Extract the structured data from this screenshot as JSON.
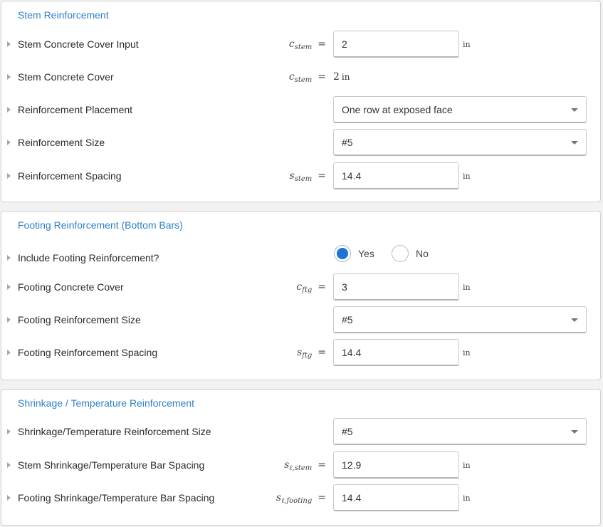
{
  "stem": {
    "title": "Stem Reinforcement",
    "rows": {
      "cover_input": {
        "label": "Stem Concrete Cover Input",
        "sym": "c",
        "sub": "stem",
        "value": "2",
        "unit": "in"
      },
      "cover": {
        "label": "Stem Concrete Cover",
        "sym": "c",
        "sub": "stem",
        "value": "2",
        "unit": "in"
      },
      "placement": {
        "label": "Reinforcement Placement",
        "value": "One row at exposed face"
      },
      "size": {
        "label": "Reinforcement Size",
        "value": "#5"
      },
      "spacing": {
        "label": "Reinforcement Spacing",
        "sym": "s",
        "sub": "stem",
        "value": "14.4",
        "unit": "in"
      }
    }
  },
  "footing": {
    "title": "Footing Reinforcement (Bottom Bars)",
    "rows": {
      "include": {
        "label": "Include Footing Reinforcement?",
        "yes": "Yes",
        "no": "No",
        "selected": "Yes"
      },
      "cover": {
        "label": "Footing Concrete Cover",
        "sym": "c",
        "sub": "ftg",
        "value": "3",
        "unit": "in"
      },
      "size": {
        "label": "Footing Reinforcement Size",
        "value": "#5"
      },
      "spacing": {
        "label": "Footing Reinforcement Spacing",
        "sym": "s",
        "sub": "ftg",
        "value": "14.4",
        "unit": "in"
      }
    }
  },
  "shrinkage": {
    "title": "Shrinkage / Temperature Reinforcement",
    "rows": {
      "size": {
        "label": "Shrinkage/Temperature Reinforcement Size",
        "value": "#5"
      },
      "stem_spacing": {
        "label": "Stem Shrinkage/Temperature Bar Spacing",
        "sym": "s",
        "sub": "ℓ,stem",
        "value": "12.9",
        "unit": "in"
      },
      "footing_spacing": {
        "label": "Footing Shrinkage/Temperature Bar Spacing",
        "sym": "s",
        "sub": "ℓ,footing",
        "value": "14.4",
        "unit": "in"
      }
    }
  },
  "symbols": {
    "equals": "="
  },
  "colors": {
    "accent": "#2f7fc8",
    "radio_on": "#1a73d6"
  }
}
